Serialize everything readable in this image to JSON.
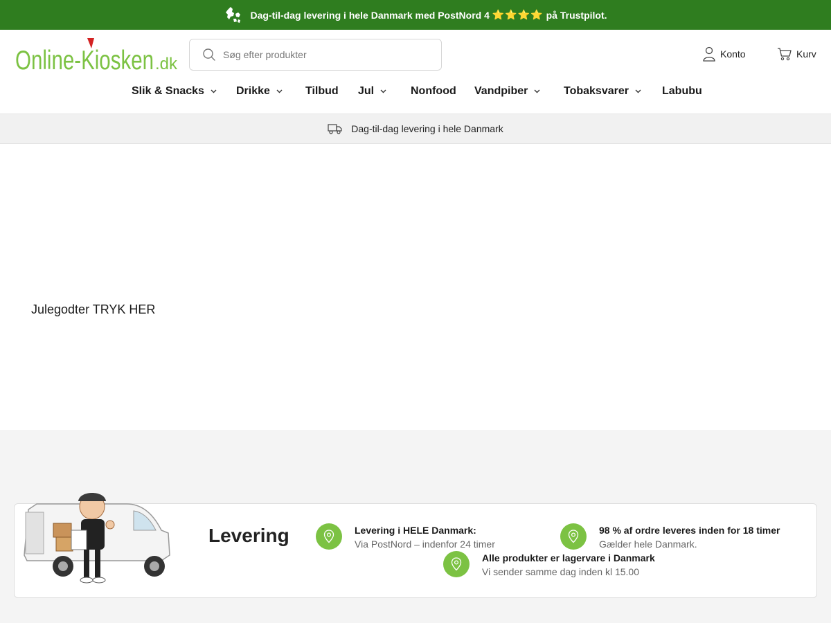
{
  "announcement": {
    "text_before": "Dag-til-dag levering i hele Danmark med PostNord 4",
    "stars": "⭐⭐⭐⭐",
    "text_after": "på Trustpilot.",
    "bg_color": "#2f7d1f"
  },
  "header": {
    "logo_text_main": "Online-Kiosken",
    "logo_text_tld": ".dk",
    "search_placeholder": "Søg efter produkter",
    "account_label": "Konto",
    "cart_label": "Kurv"
  },
  "nav": {
    "items": [
      {
        "label": "Slik & Snacks",
        "has_dropdown": true
      },
      {
        "label": "Drikke",
        "has_dropdown": true
      },
      {
        "label": "Tilbud",
        "has_dropdown": false
      },
      {
        "label": "Jul",
        "has_dropdown": true
      },
      {
        "label": "Nonfood",
        "has_dropdown": false
      },
      {
        "label": "Vandpiber",
        "has_dropdown": true
      },
      {
        "label": "Tobaksvarer",
        "has_dropdown": true
      },
      {
        "label": "Labubu",
        "has_dropdown": false
      }
    ]
  },
  "infobar": {
    "text": "Dag-til-dag levering i hele Danmark",
    "icon": "truck-icon"
  },
  "main": {
    "promo_link": "Julegodter TRYK HER"
  },
  "delivery": {
    "title": "Levering",
    "features": [
      {
        "title": "Levering i HELE Danmark:",
        "subtitle": "Via PostNord – indenfor 24 timer",
        "icon": "location-pin-icon"
      },
      {
        "title": "98 % af ordre leveres inden for 18 timer",
        "subtitle": "Gælder hele Danmark.",
        "icon": "location-pin-icon"
      },
      {
        "title": "Alle produkter er lagervare i Danmark",
        "subtitle": "Vi sender samme dag inden kl 15.00",
        "icon": "location-pin-icon"
      }
    ],
    "accent_color": "#7cc243"
  }
}
